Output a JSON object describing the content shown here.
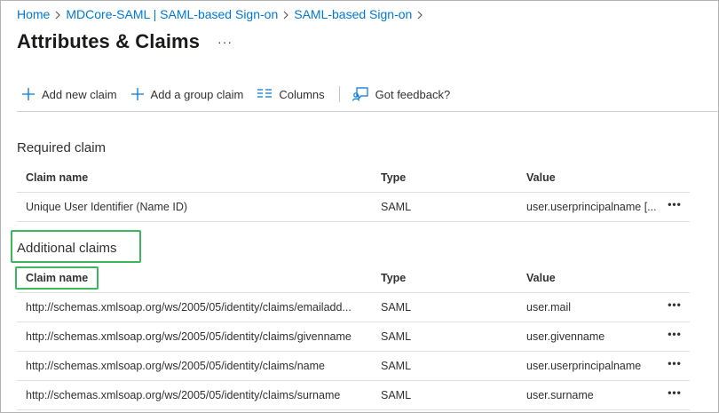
{
  "breadcrumb": {
    "items": [
      "Home",
      "MDCore-SAML | SAML-based Sign-on",
      "SAML-based Sign-on"
    ]
  },
  "page": {
    "title": "Attributes & Claims",
    "more_label": "···"
  },
  "toolbar": {
    "add_new_claim": "Add new claim",
    "add_group_claim": "Add a group claim",
    "columns": "Columns",
    "feedback": "Got feedback?"
  },
  "required": {
    "title": "Required claim",
    "headers": {
      "name": "Claim name",
      "type": "Type",
      "value": "Value"
    },
    "rows": [
      {
        "name": "Unique User Identifier (Name ID)",
        "type": "SAML",
        "value": "user.userprincipalname [..."
      }
    ]
  },
  "additional": {
    "title": "Additional claims",
    "headers": {
      "name": "Claim name",
      "type": "Type",
      "value": "Value"
    },
    "rows": [
      {
        "name": "http://schemas.xmlsoap.org/ws/2005/05/identity/claims/emailadd...",
        "type": "SAML",
        "value": "user.mail"
      },
      {
        "name": "http://schemas.xmlsoap.org/ws/2005/05/identity/claims/givenname",
        "type": "SAML",
        "value": "user.givenname"
      },
      {
        "name": "http://schemas.xmlsoap.org/ws/2005/05/identity/claims/name",
        "type": "SAML",
        "value": "user.userprincipalname"
      },
      {
        "name": "http://schemas.xmlsoap.org/ws/2005/05/identity/claims/surname",
        "type": "SAML",
        "value": "user.surname"
      }
    ]
  },
  "colors": {
    "link": "#0078d4",
    "highlight": "#3cb55c",
    "text": "#323130"
  },
  "icons": {
    "add": "plus-icon",
    "columns": "columns-icon",
    "feedback": "feedback-icon",
    "more": "more-icon"
  }
}
